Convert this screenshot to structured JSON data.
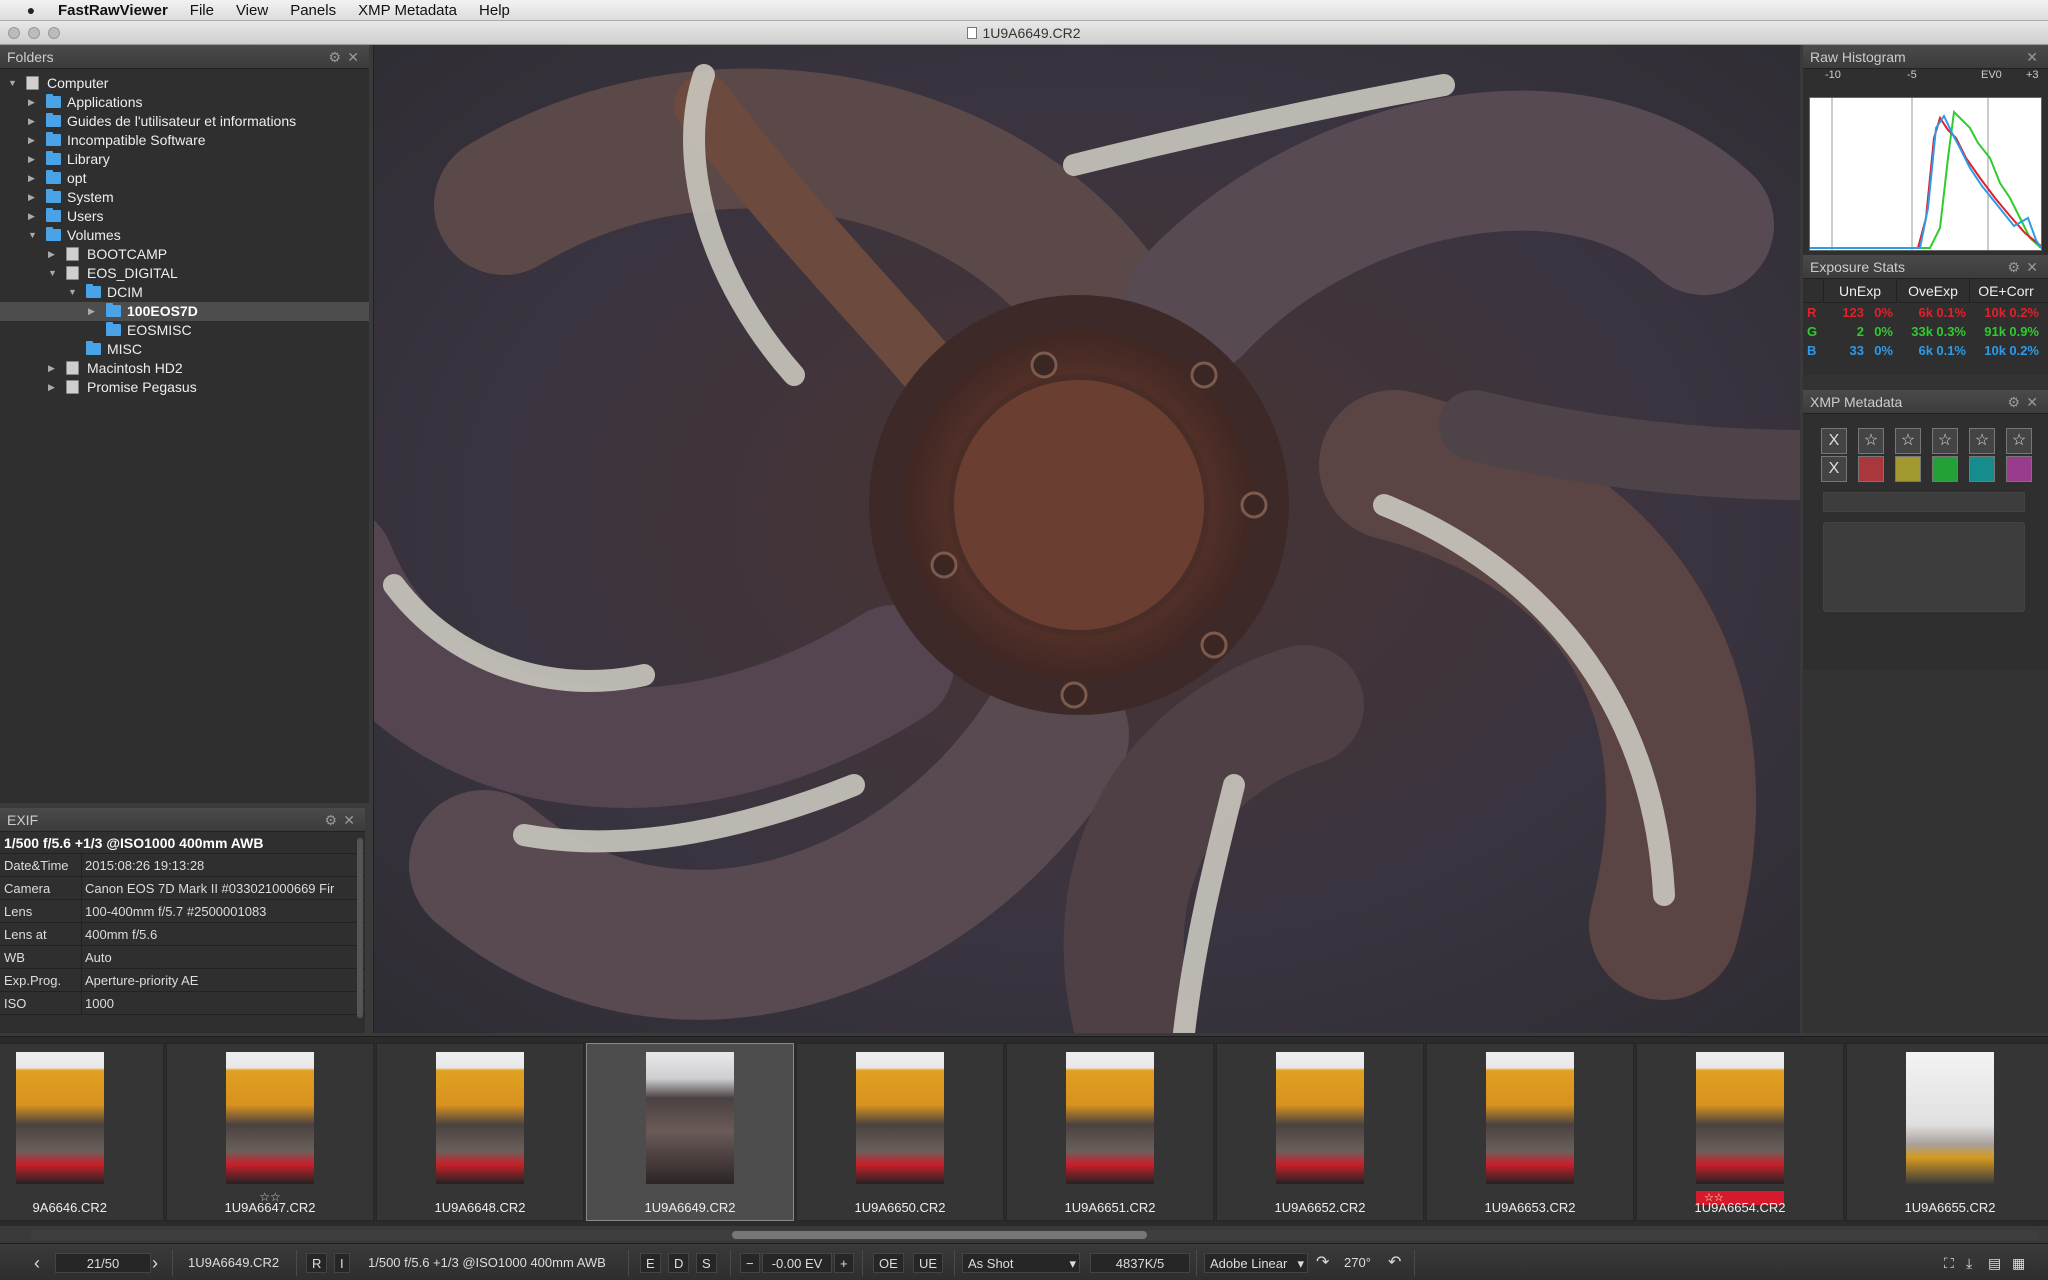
{
  "menubar": {
    "apple_icon": "apple-icon",
    "app": "FastRawViewer",
    "items": [
      "File",
      "View",
      "Panels",
      "XMP Metadata",
      "Help"
    ]
  },
  "window": {
    "title": "1U9A6649.CR2"
  },
  "folders": {
    "title": "Folders",
    "tree": [
      {
        "label": "Computer",
        "depth": 0,
        "icon": "drive",
        "expanded": true
      },
      {
        "label": "Applications",
        "depth": 1,
        "icon": "folder"
      },
      {
        "label": "Guides de l'utilisateur et informations",
        "depth": 1,
        "icon": "folder"
      },
      {
        "label": "Incompatible Software",
        "depth": 1,
        "icon": "folder"
      },
      {
        "label": "Library",
        "depth": 1,
        "icon": "folder"
      },
      {
        "label": "opt",
        "depth": 1,
        "icon": "folder"
      },
      {
        "label": "System",
        "depth": 1,
        "icon": "folder"
      },
      {
        "label": "Users",
        "depth": 1,
        "icon": "folder"
      },
      {
        "label": "Volumes",
        "depth": 1,
        "icon": "folder",
        "expanded": true
      },
      {
        "label": "BOOTCAMP",
        "depth": 2,
        "icon": "drive"
      },
      {
        "label": "EOS_DIGITAL",
        "depth": 2,
        "icon": "drive",
        "expanded": true
      },
      {
        "label": "DCIM",
        "depth": 3,
        "icon": "folder",
        "expanded": true
      },
      {
        "label": "100EOS7D",
        "depth": 4,
        "icon": "folder",
        "selected": true
      },
      {
        "label": "EOSMISC",
        "depth": 4,
        "icon": "folder",
        "leaf": true
      },
      {
        "label": "MISC",
        "depth": 3,
        "icon": "folder",
        "leaf": true
      },
      {
        "label": "Macintosh HD2",
        "depth": 2,
        "icon": "drive"
      },
      {
        "label": "Promise Pegasus",
        "depth": 2,
        "icon": "drive"
      }
    ]
  },
  "exif": {
    "title": "EXIF",
    "summary": "1/500 f/5.6 +1/3 @ISO1000 400mm AWB",
    "rows": [
      {
        "k": "Date&Time",
        "v": "2015:08:26 19:13:28"
      },
      {
        "k": "Camera",
        "v": "Canon EOS 7D Mark II #033021000669 Fir"
      },
      {
        "k": "Lens",
        "v": "100-400mm f/5.7 #2500001083"
      },
      {
        "k": "Lens at",
        "v": "400mm f/5.6"
      },
      {
        "k": "WB",
        "v": "Auto"
      },
      {
        "k": "Exp.Prog.",
        "v": "Aperture-priority AE"
      },
      {
        "k": "ISO",
        "v": "1000"
      }
    ]
  },
  "histogram": {
    "title": "Raw Histogram",
    "ticks": [
      "-10",
      "-5",
      "EV0",
      "+3"
    ]
  },
  "exposure_stats": {
    "title": "Exposure Stats",
    "headers": [
      "UnExp",
      "OveExp",
      "OE+Corr"
    ],
    "rows": [
      {
        "ch": "R",
        "color": "#e0202a",
        "un": "123",
        "unp": "0%",
        "ov": "6k",
        "ovp": "0.1%",
        "oc": "10k",
        "ocp": "0.2%"
      },
      {
        "ch": "G",
        "color": "#2ecc2e",
        "un": "2",
        "unp": "0%",
        "ov": "33k",
        "ovp": "0.3%",
        "oc": "91k",
        "ocp": "0.9%"
      },
      {
        "ch": "B",
        "color": "#2d9be8",
        "un": "33",
        "unp": "0%",
        "ov": "6k",
        "ovp": "0.1%",
        "oc": "10k",
        "ocp": "0.2%"
      }
    ]
  },
  "xmp": {
    "title": "XMP Metadata",
    "reject": "X",
    "star": "☆",
    "label_colors": [
      "#a8383c",
      "#a29a30",
      "#25a038",
      "#178c8c",
      "#9a3c8e"
    ]
  },
  "filmstrip": {
    "thumbs": [
      {
        "name": "9A6646.CR2",
        "stars": ""
      },
      {
        "name": "1U9A6647.CR2",
        "stars": "☆☆"
      },
      {
        "name": "1U9A6648.CR2",
        "stars": ""
      },
      {
        "name": "1U9A6649.CR2",
        "stars": "",
        "selected": true
      },
      {
        "name": "1U9A6650.CR2",
        "stars": ""
      },
      {
        "name": "1U9A6651.CR2",
        "stars": ""
      },
      {
        "name": "1U9A6652.CR2",
        "stars": ""
      },
      {
        "name": "1U9A6653.CR2",
        "stars": ""
      },
      {
        "name": "1U9A6654.CR2",
        "stars": "☆☆",
        "redlabel": true
      },
      {
        "name": "1U9A6655.CR2",
        "stars": ""
      }
    ]
  },
  "statusbar": {
    "prev": "‹",
    "counter": "21/50",
    "next": "›",
    "filename": "1U9A6649.CR2",
    "r_btn": "R",
    "i_btn": "I",
    "exposure_summary": "1/500 f/5.6 +1/3 @ISO1000 400mm AWB",
    "e_btn": "E",
    "d_btn": "D",
    "s_btn": "S",
    "minus": "−",
    "ev": "-0.00 EV",
    "plus": "+",
    "oe": "OE",
    "ue": "UE",
    "wb": "As Shot",
    "temp": "4837K/5",
    "profile": "Adobe Linear",
    "rotation": "270°"
  }
}
